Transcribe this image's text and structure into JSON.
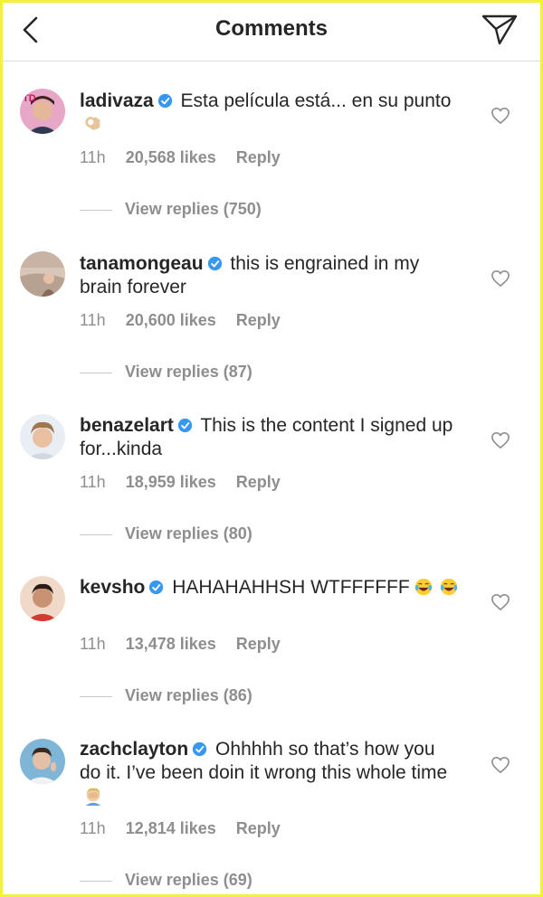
{
  "header": {
    "title": "Comments",
    "back_icon": "chevron-left-icon",
    "send_icon": "paper-plane-icon"
  },
  "comments": [
    {
      "username": "ladivaza",
      "text": "Esta película está... en su punto",
      "emoji": "ok-hand-emoji",
      "time": "11h",
      "likes": "20,568 likes",
      "reply": "Reply",
      "view_replies": "View replies (750)"
    },
    {
      "username": "tanamongeau",
      "text": "this is engrained in my brain forever",
      "time": "11h",
      "likes": "20,600 likes",
      "reply": "Reply",
      "view_replies": "View replies (87)"
    },
    {
      "username": "benazelart",
      "text": "This is the content I signed up for...kinda",
      "time": "11h",
      "likes": "18,959 likes",
      "reply": "Reply",
      "view_replies": "View replies (80)"
    },
    {
      "username": "kevsho",
      "text": "HAHAHAHHSH WTFFFFFF",
      "emoji": "tears-of-joy-emoji",
      "time": "11h",
      "likes": "13,478 likes",
      "reply": "Reply",
      "view_replies": "View replies (86)"
    },
    {
      "username": "zachclayton",
      "text": "Ohhhhh so that’s how you do it. I’ve been doin it wrong this whole time",
      "emoji": "facepalm-emoji",
      "time": "11h",
      "likes": "12,814 likes",
      "reply": "Reply",
      "view_replies": "View replies (69)"
    }
  ],
  "colors": {
    "text": "#262626",
    "secondary": "#8e8e8e",
    "verified": "#3897f0",
    "frame": "#f2f23c"
  }
}
